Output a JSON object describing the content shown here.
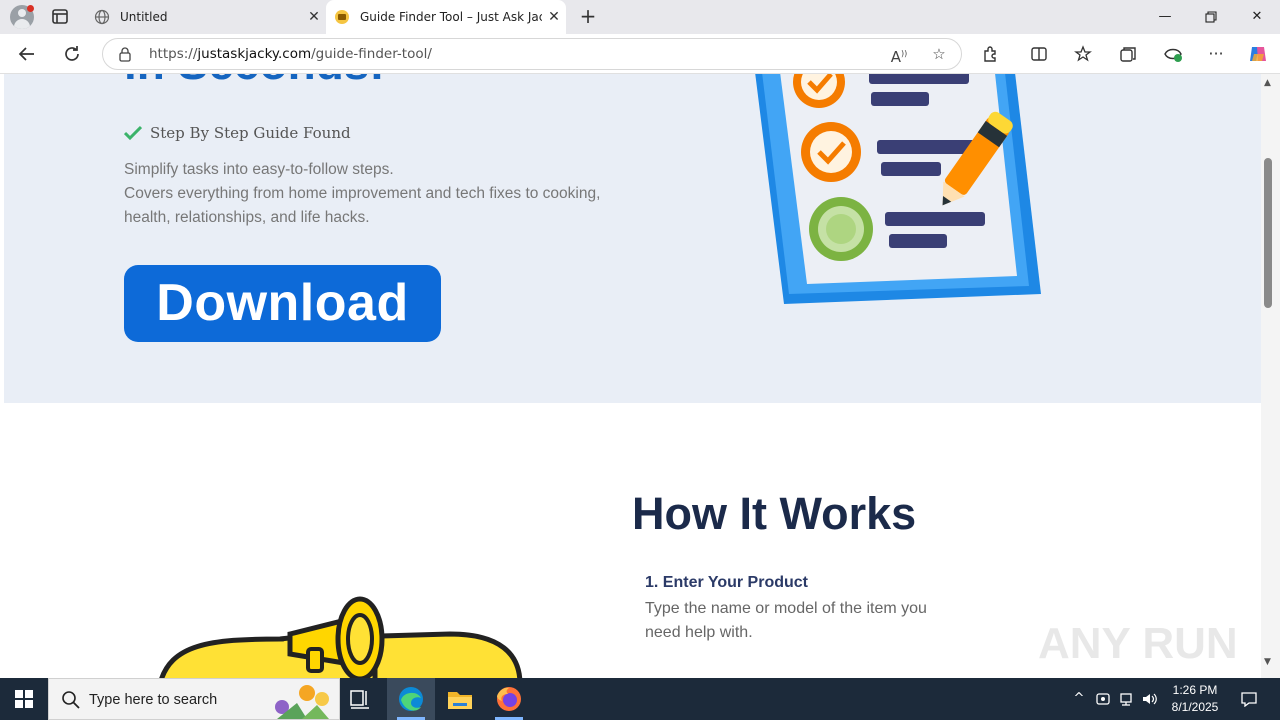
{
  "browser": {
    "tabs": [
      {
        "title": "Untitled",
        "active": false
      },
      {
        "title": "Guide Finder Tool – Just Ask Jacky",
        "active": true
      }
    ],
    "new_tab_icon": "plus-icon",
    "address": {
      "url_prefix": "https://",
      "url_domain": "justaskjacky.com",
      "url_path": "/guide-finder-tool/"
    },
    "window_controls": [
      "minimize-icon",
      "restore-icon",
      "close-icon"
    ]
  },
  "page": {
    "hero": {
      "partial_heading": "in Seconds!",
      "check_label": "Step By Step Guide Found",
      "description": [
        "Simplify tasks into easy-to-follow steps.",
        "Covers everything from home improvement and tech fixes to cooking,",
        "health, relationships, and life hacks."
      ],
      "download_button": "Download"
    },
    "how_it_works": {
      "title": "How It Works",
      "steps": [
        {
          "title": "1. Enter Your Product",
          "description": "Type the name or model of the item you need help with."
        }
      ]
    },
    "watermark": "ANY RUN"
  },
  "taskbar": {
    "search_placeholder": "Type here to search",
    "time": "1:26 PM",
    "date": "8/1/2025"
  },
  "colors": {
    "hero_bg": "#e9eef6",
    "download_button": "#0d6ad8",
    "check_green": "#3bb36a",
    "heading_navy": "#1b2a4a",
    "taskbar": "#1c2a3a"
  }
}
